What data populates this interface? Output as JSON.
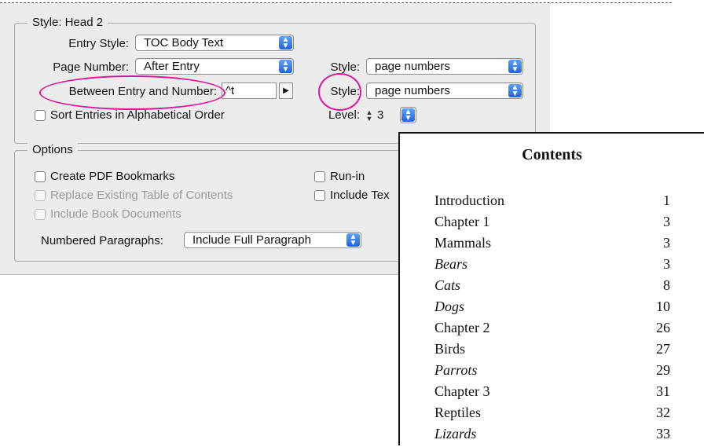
{
  "style_group": {
    "title": "Style: Head 2",
    "entry_style": {
      "label": "Entry Style:",
      "value": "TOC Body Text"
    },
    "page_number": {
      "label": "Page Number:",
      "value": "After Entry"
    },
    "page_number_style": {
      "label": "Style:",
      "value": "page numbers"
    },
    "between_entry": {
      "label": "Between Entry and Number:",
      "value": "^t"
    },
    "between_style": {
      "label": "Style:",
      "value": "page numbers"
    },
    "sort_entries": {
      "label": "Sort Entries in Alphabetical Order",
      "checked": false
    },
    "level": {
      "label": "Level:",
      "value": "3"
    }
  },
  "options_group": {
    "title": "Options",
    "create_pdf_bookmarks": {
      "label": "Create PDF Bookmarks",
      "checked": false
    },
    "replace_existing": {
      "label": "Replace Existing Table of Contents",
      "enabled": false
    },
    "include_book_documents": {
      "label": "Include Book Documents",
      "enabled": false
    },
    "run_in": {
      "label": "Run-in",
      "checked": false
    },
    "include_text": {
      "label": "Include Tex"
    },
    "numbered_paragraphs": {
      "label": "Numbered Paragraphs:",
      "value": "Include Full Paragraph"
    }
  },
  "highlight_color": "#e0159a",
  "contents": {
    "title": "Contents",
    "entries": [
      {
        "text": "Introduction",
        "page": "1",
        "italic": false
      },
      {
        "text": "Chapter 1",
        "page": "3",
        "italic": false
      },
      {
        "text": "Mammals",
        "page": "3",
        "italic": false
      },
      {
        "text": "Bears",
        "page": "3",
        "italic": true
      },
      {
        "text": "Cats",
        "page": "8",
        "italic": true
      },
      {
        "text": "Dogs",
        "page": "10",
        "italic": true
      },
      {
        "text": "Chapter 2",
        "page": "26",
        "italic": false
      },
      {
        "text": "Birds",
        "page": "27",
        "italic": false
      },
      {
        "text": "Parrots",
        "page": "29",
        "italic": true
      },
      {
        "text": "Chapter 3",
        "page": "31",
        "italic": false
      },
      {
        "text": "Reptiles",
        "page": "32",
        "italic": false
      },
      {
        "text": "Lizards",
        "page": "33",
        "italic": true
      }
    ]
  }
}
